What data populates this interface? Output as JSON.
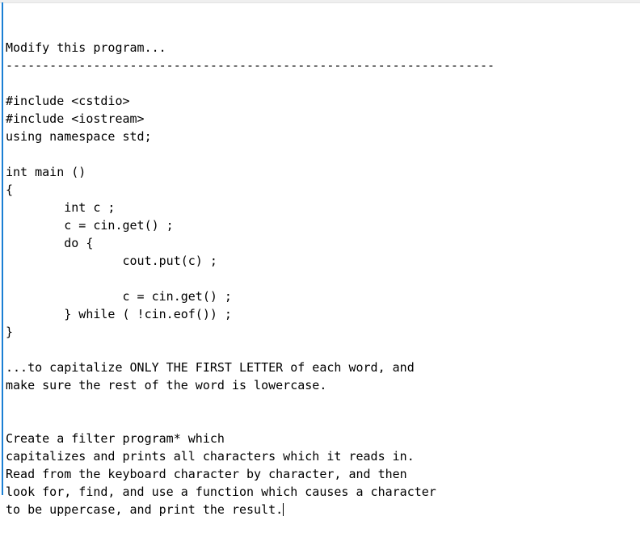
{
  "window": {
    "top_strip_color": "#efefef",
    "accent_color": "#1a7fd4",
    "background_color": "#ffffff",
    "text_color": "#000000"
  },
  "text_field": {
    "name": "assignment-text-area",
    "caret_visible": true,
    "lines": [
      "Modify this program...",
      "-------------------------------------------------------------------",
      "",
      "#include <cstdio>",
      "#include <iostream>",
      "using namespace std;",
      "",
      "int main ()",
      "{",
      "        int c ;",
      "        c = cin.get() ;",
      "        do {",
      "                cout.put(c) ;",
      "",
      "                c = cin.get() ;",
      "        } while ( !cin.eof()) ;",
      "}",
      "",
      "...to capitalize ONLY THE FIRST LETTER of each word, and",
      "make sure the rest of the word is lowercase.",
      "",
      "",
      "Create a filter program* which",
      "capitalizes and prints all characters which it reads in.",
      "Read from the keyboard character by character, and then",
      "look for, find, and use a function which causes a character",
      "to be uppercase, and print the result."
    ]
  }
}
